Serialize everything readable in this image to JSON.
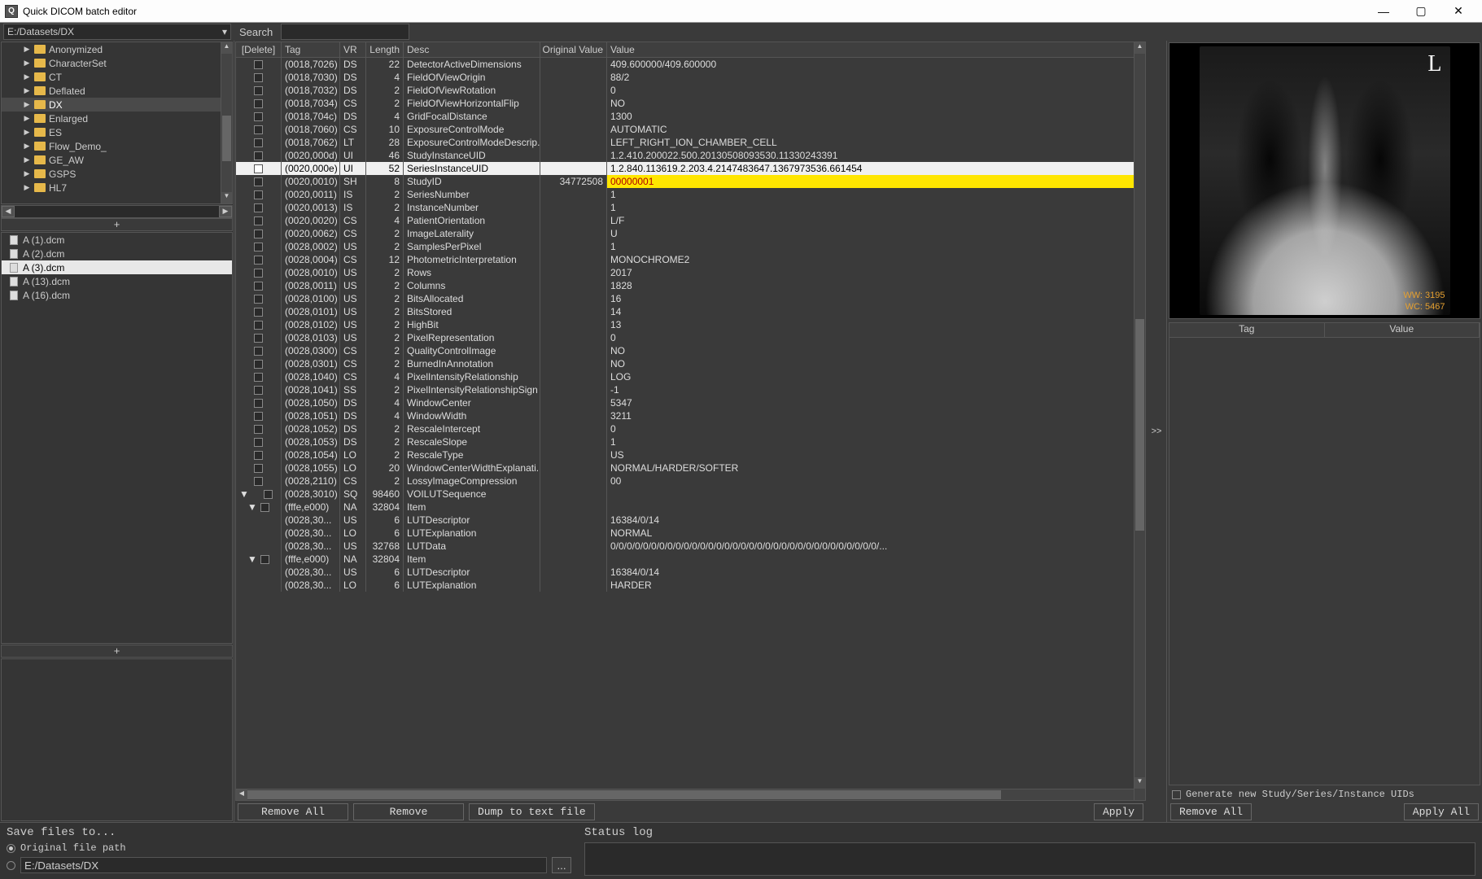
{
  "window": {
    "title": "Quick DICOM batch editor",
    "icon_letter": "Q"
  },
  "path_combo": "E:/Datasets/DX",
  "search": {
    "label": "Search",
    "value": ""
  },
  "folders": [
    {
      "name": "Anonymized"
    },
    {
      "name": "CharacterSet"
    },
    {
      "name": "CT"
    },
    {
      "name": "Deflated"
    },
    {
      "name": "DX",
      "selected": true
    },
    {
      "name": "Enlarged"
    },
    {
      "name": "ES"
    },
    {
      "name": "Flow_Demo_"
    },
    {
      "name": "GE_AW"
    },
    {
      "name": "GSPS"
    },
    {
      "name": "HL7"
    }
  ],
  "add_button": "+",
  "files": [
    {
      "name": "A (1).dcm"
    },
    {
      "name": "A (2).dcm"
    },
    {
      "name": "A (3).dcm",
      "selected": true
    },
    {
      "name": "A (13).dcm"
    },
    {
      "name": "A (16).dcm"
    }
  ],
  "table": {
    "headers": {
      "delete": "[Delete]",
      "tag": "Tag",
      "vr": "VR",
      "length": "Length",
      "desc": "Desc",
      "orig": "Original Value",
      "value": "Value"
    },
    "rows": [
      {
        "tag": "(0018,7026)",
        "vr": "DS",
        "len": "22",
        "desc": "DetectorActiveDimensions",
        "val": "409.600000/409.600000"
      },
      {
        "tag": "(0018,7030)",
        "vr": "DS",
        "len": "4",
        "desc": "FieldOfViewOrigin",
        "val": "88/2"
      },
      {
        "tag": "(0018,7032)",
        "vr": "DS",
        "len": "2",
        "desc": "FieldOfViewRotation",
        "val": "0"
      },
      {
        "tag": "(0018,7034)",
        "vr": "CS",
        "len": "2",
        "desc": "FieldOfViewHorizontalFlip",
        "val": "NO"
      },
      {
        "tag": "(0018,704c)",
        "vr": "DS",
        "len": "4",
        "desc": "GridFocalDistance",
        "val": "1300"
      },
      {
        "tag": "(0018,7060)",
        "vr": "CS",
        "len": "10",
        "desc": "ExposureControlMode",
        "val": "AUTOMATIC"
      },
      {
        "tag": "(0018,7062)",
        "vr": "LT",
        "len": "28",
        "desc": "ExposureControlModeDescrip...",
        "val": "LEFT_RIGHT_ION_CHAMBER_CELL"
      },
      {
        "tag": "(0020,000d)",
        "vr": "UI",
        "len": "46",
        "desc": "StudyInstanceUID",
        "val": "1.2.410.200022.500.20130508093530.11330243391"
      },
      {
        "tag": "(0020,000e)",
        "vr": "UI",
        "len": "52",
        "desc": "SeriesInstanceUID",
        "val": "1.2.840.113619.2.203.4.2147483647.1367973536.661454",
        "selected": true
      },
      {
        "tag": "(0020,0010)",
        "vr": "SH",
        "len": "8",
        "desc": "StudyID",
        "orig": "34772508",
        "val": "00000001",
        "hl": true
      },
      {
        "tag": "(0020,0011)",
        "vr": "IS",
        "len": "2",
        "desc": "SeriesNumber",
        "val": "1"
      },
      {
        "tag": "(0020,0013)",
        "vr": "IS",
        "len": "2",
        "desc": "InstanceNumber",
        "val": "1"
      },
      {
        "tag": "(0020,0020)",
        "vr": "CS",
        "len": "4",
        "desc": "PatientOrientation",
        "val": "L/F"
      },
      {
        "tag": "(0020,0062)",
        "vr": "CS",
        "len": "2",
        "desc": "ImageLaterality",
        "val": "U"
      },
      {
        "tag": "(0028,0002)",
        "vr": "US",
        "len": "2",
        "desc": "SamplesPerPixel",
        "val": "1"
      },
      {
        "tag": "(0028,0004)",
        "vr": "CS",
        "len": "12",
        "desc": "PhotometricInterpretation",
        "val": "MONOCHROME2"
      },
      {
        "tag": "(0028,0010)",
        "vr": "US",
        "len": "2",
        "desc": "Rows",
        "val": "2017"
      },
      {
        "tag": "(0028,0011)",
        "vr": "US",
        "len": "2",
        "desc": "Columns",
        "val": "1828"
      },
      {
        "tag": "(0028,0100)",
        "vr": "US",
        "len": "2",
        "desc": "BitsAllocated",
        "val": "16"
      },
      {
        "tag": "(0028,0101)",
        "vr": "US",
        "len": "2",
        "desc": "BitsStored",
        "val": "14"
      },
      {
        "tag": "(0028,0102)",
        "vr": "US",
        "len": "2",
        "desc": "HighBit",
        "val": "13"
      },
      {
        "tag": "(0028,0103)",
        "vr": "US",
        "len": "2",
        "desc": "PixelRepresentation",
        "val": "0"
      },
      {
        "tag": "(0028,0300)",
        "vr": "CS",
        "len": "2",
        "desc": "QualityControlImage",
        "val": "NO"
      },
      {
        "tag": "(0028,0301)",
        "vr": "CS",
        "len": "2",
        "desc": "BurnedInAnnotation",
        "val": "NO"
      },
      {
        "tag": "(0028,1040)",
        "vr": "CS",
        "len": "4",
        "desc": "PixelIntensityRelationship",
        "val": "LOG"
      },
      {
        "tag": "(0028,1041)",
        "vr": "SS",
        "len": "2",
        "desc": "PixelIntensityRelationshipSign",
        "val": "-1"
      },
      {
        "tag": "(0028,1050)",
        "vr": "DS",
        "len": "4",
        "desc": "WindowCenter",
        "val": "5347"
      },
      {
        "tag": "(0028,1051)",
        "vr": "DS",
        "len": "4",
        "desc": "WindowWidth",
        "val": "3211"
      },
      {
        "tag": "(0028,1052)",
        "vr": "DS",
        "len": "2",
        "desc": "RescaleIntercept",
        "val": "0"
      },
      {
        "tag": "(0028,1053)",
        "vr": "DS",
        "len": "2",
        "desc": "RescaleSlope",
        "val": "1"
      },
      {
        "tag": "(0028,1054)",
        "vr": "LO",
        "len": "2",
        "desc": "RescaleType",
        "val": "US"
      },
      {
        "tag": "(0028,1055)",
        "vr": "LO",
        "len": "20",
        "desc": "WindowCenterWidthExplanati...",
        "val": "NORMAL/HARDER/SOFTER"
      },
      {
        "tag": "(0028,2110)",
        "vr": "CS",
        "len": "2",
        "desc": "LossyImageCompression",
        "val": "00"
      },
      {
        "tag": "(0028,3010)",
        "vr": "SQ",
        "len": "98460",
        "desc": "VOILUTSequence",
        "val": "",
        "exp": true
      },
      {
        "tag": "(fffe,e000)",
        "vr": "NA",
        "len": "32804",
        "desc": "Item",
        "val": "",
        "sub": 1,
        "exp": true
      },
      {
        "tag": "(0028,30...",
        "vr": "US",
        "len": "6",
        "desc": "LUTDescriptor",
        "val": "16384/0/14",
        "sub": 2
      },
      {
        "tag": "(0028,30...",
        "vr": "LO",
        "len": "6",
        "desc": "LUTExplanation",
        "val": "NORMAL",
        "sub": 2
      },
      {
        "tag": "(0028,30...",
        "vr": "US",
        "len": "32768",
        "desc": "LUTData",
        "val": "0/0/0/0/0/0/0/0/0/0/0/0/0/0/0/0/0/0/0/0/0/0/0/0/0/0/0/0/0/0/0/0/0/...",
        "sub": 2
      },
      {
        "tag": "(fffe,e000)",
        "vr": "NA",
        "len": "32804",
        "desc": "Item",
        "val": "",
        "sub": 1,
        "exp": true
      },
      {
        "tag": "(0028,30...",
        "vr": "US",
        "len": "6",
        "desc": "LUTDescriptor",
        "val": "16384/0/14",
        "sub": 2
      },
      {
        "tag": "(0028,30...",
        "vr": "LO",
        "len": "6",
        "desc": "LUTExplanation",
        "val": "HARDER",
        "sub": 2
      }
    ]
  },
  "preview": {
    "laterality": "L",
    "ww": "WW: 3195",
    "wc": "WC: 5467"
  },
  "tv_panel": {
    "tag_header": "Tag",
    "value_header": "Value"
  },
  "expand_btn": ">>",
  "gen_uid_label": "Generate new Study/Series/Instance UIDs",
  "buttons": {
    "remove_all_left": "Remove All",
    "remove": "Remove",
    "dump": "Dump to text file",
    "apply": "Apply",
    "remove_all_right": "Remove All",
    "apply_all": "Apply All"
  },
  "save": {
    "title": "Save files to...",
    "original": "Original file path",
    "path": "E:/Datasets/DX",
    "browse": "..."
  },
  "status": {
    "title": "Status log"
  }
}
